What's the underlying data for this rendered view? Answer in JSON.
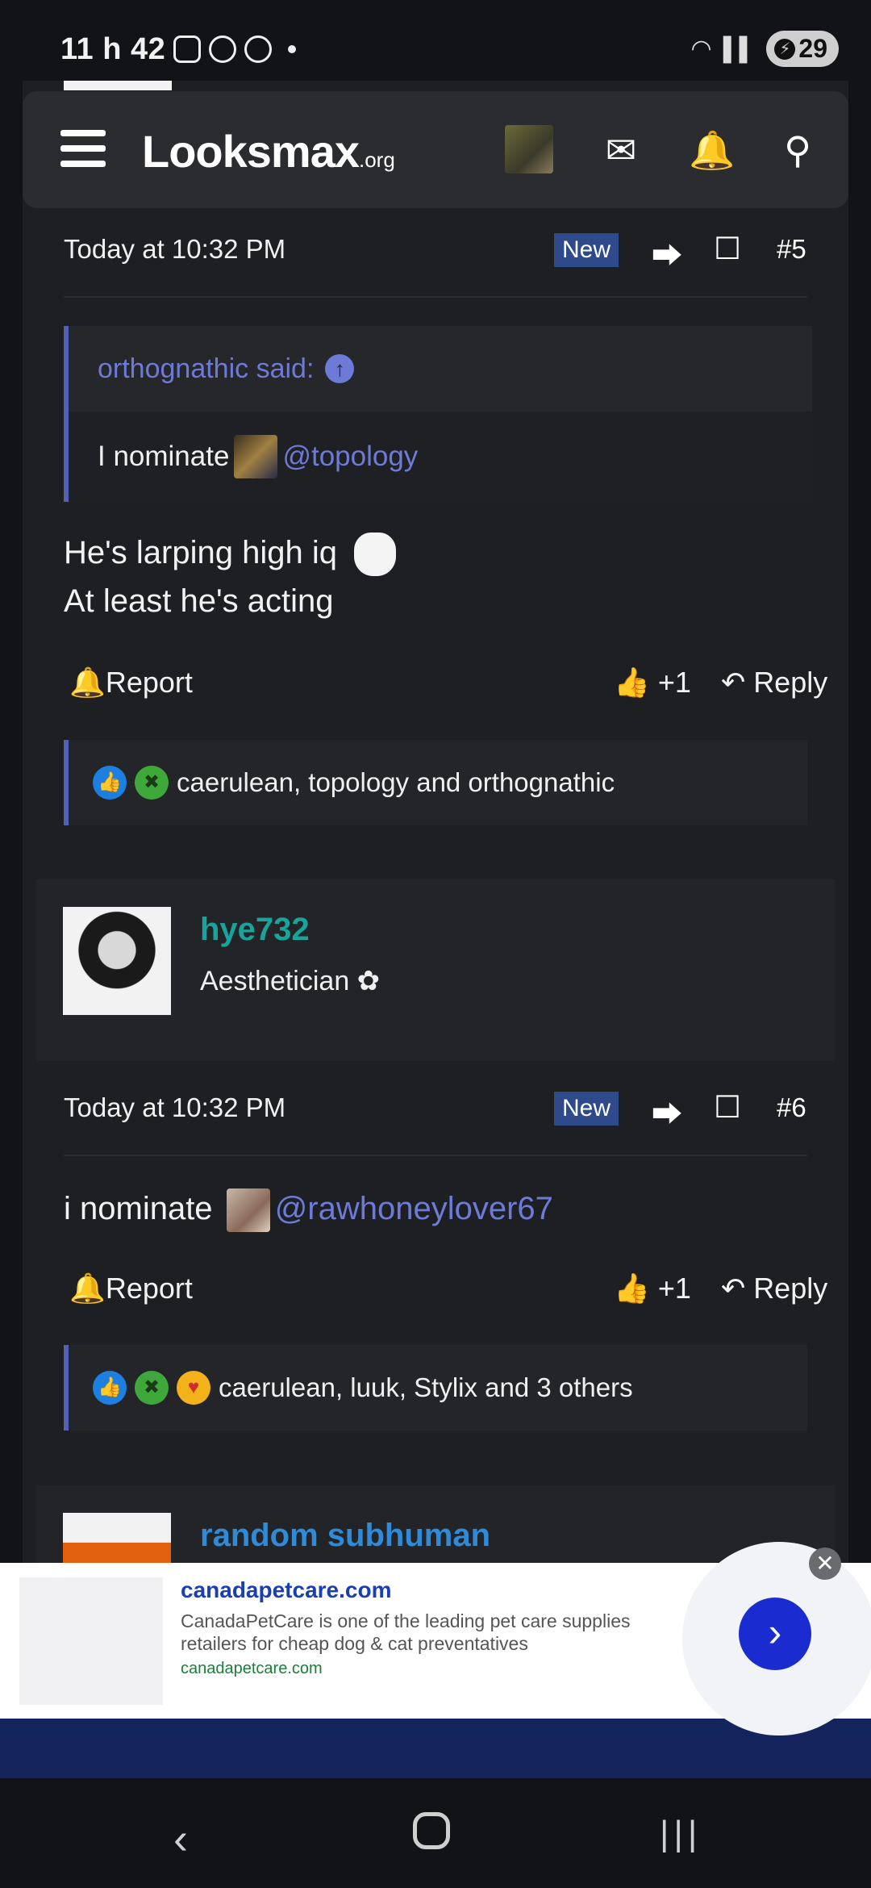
{
  "status": {
    "time": "11 h 42",
    "battery": "29"
  },
  "header": {
    "logo_main": "Looksmax",
    "logo_tld": ".org"
  },
  "post5": {
    "time": "Today at 10:32 PM",
    "badge": "New",
    "number": "#5",
    "quote_author": "orthognathic said:",
    "quote_text": "I nominate",
    "quote_mention": "@topology",
    "message_line1": "He's larping high iq",
    "message_line2": "At least he's acting",
    "report_label": "Report",
    "like_count": "+1",
    "reply_label": "Reply",
    "reactions_text": "caerulean, topology and orthognathic"
  },
  "user6": {
    "name": "hye732",
    "title": "Aesthetician ✿",
    "name_color": "#1aa39a"
  },
  "post6": {
    "time": "Today at 10:32 PM",
    "badge": "New",
    "number": "#6",
    "message_text": "i nominate",
    "mention": "@rawhoneylover67",
    "report_label": "Report",
    "like_count": "+1",
    "reply_label": "Reply",
    "reactions_text": "caerulean, luuk, Stylix and 3 others"
  },
  "user7": {
    "name": "random subhuman",
    "name_color": "#2f8ad8"
  },
  "ad": {
    "title": "canadapetcare.com",
    "description": "CanadaPetCare is one of the leading pet care supplies retailers for cheap dog & cat preventatives",
    "url": "canadapetcare.com"
  }
}
